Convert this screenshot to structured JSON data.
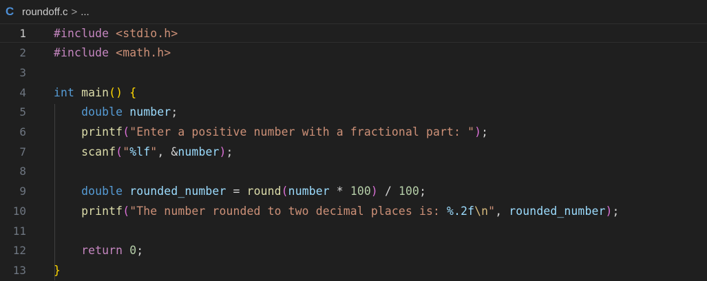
{
  "breadcrumb": {
    "language_icon": "C",
    "file": "roundoff.c",
    "separator": ">",
    "ellipsis": "..."
  },
  "editor": {
    "current_line": 1,
    "lines": [
      {
        "number": "1",
        "tokens": [
          [
            "pre",
            "#include "
          ],
          [
            "inc",
            "<stdio.h>"
          ]
        ]
      },
      {
        "number": "2",
        "tokens": [
          [
            "pre",
            "#include "
          ],
          [
            "inc",
            "<math.h>"
          ]
        ]
      },
      {
        "number": "3",
        "tokens": []
      },
      {
        "number": "4",
        "tokens": [
          [
            "kw",
            "int "
          ],
          [
            "fn",
            "main"
          ],
          [
            "p1",
            "()"
          ],
          [
            "op",
            " "
          ],
          [
            "p1",
            "{"
          ]
        ]
      },
      {
        "number": "5",
        "tokens": [
          [
            "op",
            "    "
          ],
          [
            "kw",
            "double "
          ],
          [
            "var",
            "number"
          ],
          [
            "op",
            ";"
          ]
        ]
      },
      {
        "number": "6",
        "tokens": [
          [
            "op",
            "    "
          ],
          [
            "fn",
            "printf"
          ],
          [
            "p2",
            "("
          ],
          [
            "str",
            "\"Enter a positive number with a fractional part: \""
          ],
          [
            "p2",
            ")"
          ],
          [
            "op",
            ";"
          ]
        ]
      },
      {
        "number": "7",
        "tokens": [
          [
            "op",
            "    "
          ],
          [
            "fn",
            "scanf"
          ],
          [
            "p2",
            "("
          ],
          [
            "str",
            "\""
          ],
          [
            "fmt",
            "%lf"
          ],
          [
            "str",
            "\""
          ],
          [
            "op",
            ", &"
          ],
          [
            "var",
            "number"
          ],
          [
            "p2",
            ")"
          ],
          [
            "op",
            ";"
          ]
        ]
      },
      {
        "number": "8",
        "tokens": []
      },
      {
        "number": "9",
        "tokens": [
          [
            "op",
            "    "
          ],
          [
            "kw",
            "double "
          ],
          [
            "var",
            "rounded_number"
          ],
          [
            "op",
            " = "
          ],
          [
            "fn",
            "round"
          ],
          [
            "p2",
            "("
          ],
          [
            "var",
            "number"
          ],
          [
            "op",
            " * "
          ],
          [
            "num",
            "100"
          ],
          [
            "p2",
            ")"
          ],
          [
            "op",
            " / "
          ],
          [
            "num",
            "100"
          ],
          [
            "op",
            ";"
          ]
        ]
      },
      {
        "number": "10",
        "tokens": [
          [
            "op",
            "    "
          ],
          [
            "fn",
            "printf"
          ],
          [
            "p2",
            "("
          ],
          [
            "str",
            "\"The number rounded to two decimal places is: "
          ],
          [
            "fmt",
            "%.2f"
          ],
          [
            "esc",
            "\\n"
          ],
          [
            "str",
            "\""
          ],
          [
            "op",
            ", "
          ],
          [
            "var",
            "rounded_number"
          ],
          [
            "p2",
            ")"
          ],
          [
            "op",
            ";"
          ]
        ]
      },
      {
        "number": "11",
        "tokens": []
      },
      {
        "number": "12",
        "tokens": [
          [
            "op",
            "    "
          ],
          [
            "ret",
            "return "
          ],
          [
            "num",
            "0"
          ],
          [
            "op",
            ";"
          ]
        ]
      },
      {
        "number": "13",
        "tokens": [
          [
            "p1",
            "}"
          ]
        ]
      }
    ]
  }
}
